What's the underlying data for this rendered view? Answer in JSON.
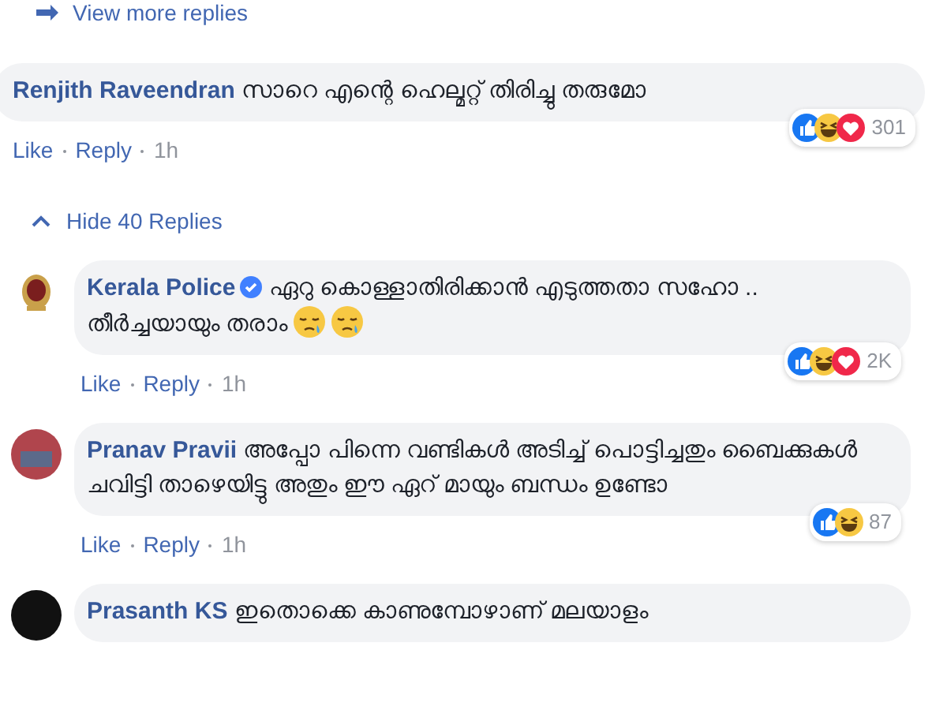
{
  "view_more": {
    "label": "View more replies"
  },
  "comments": [
    {
      "author": "Renjith Raveendran",
      "verified": false,
      "text": "സാറെ എന്റെ ഹെല്മറ്റ് തിരിച്ചു തരുമോ",
      "reactions": [
        {
          "kind": "like"
        },
        {
          "kind": "haha"
        },
        {
          "kind": "love"
        }
      ],
      "reaction_count": "301",
      "actions": [
        "Like",
        "Reply"
      ],
      "time": "1h",
      "replies_toggle": {
        "label": "Hide 40 Replies",
        "expanded": true
      },
      "children": [
        {
          "author": "Kerala Police",
          "verified": true,
          "avatar": {
            "kind": "emblem"
          },
          "text": "ഏറു കൊള്ളാതിരിക്കാൻ എടുത്തതാ സഹോ .. തീർച്ചയായും തരാം",
          "emojis": [
            {
              "kind": "crying"
            },
            {
              "kind": "crying"
            }
          ],
          "reactions": [
            {
              "kind": "like"
            },
            {
              "kind": "haha"
            },
            {
              "kind": "love"
            }
          ],
          "reaction_count": "2K",
          "actions": [
            "Like",
            "Reply"
          ],
          "time": "1h"
        },
        {
          "author": "Pranav Pravii",
          "verified": false,
          "avatar": {
            "kind": "photo"
          },
          "text": "അപ്പോ പിന്നെ വണ്ടികൾ അടിച്ച് പൊട്ടിച്ചതും ബൈക്കുകൾ ചവിട്ടി താഴെയിട്ടു അതും ഈ ഏറ് മായും ബന്ധം ഉണ്ടോ",
          "reactions": [
            {
              "kind": "like"
            },
            {
              "kind": "haha"
            }
          ],
          "reaction_count": "87",
          "actions": [
            "Like",
            "Reply"
          ],
          "time": "1h"
        },
        {
          "author": "Prasanth KS",
          "verified": false,
          "avatar": {
            "kind": "blank"
          },
          "text": "ഇതൊക്കെ കാണുമ്പോഴാണ് മലയാളം"
        }
      ]
    }
  ]
}
